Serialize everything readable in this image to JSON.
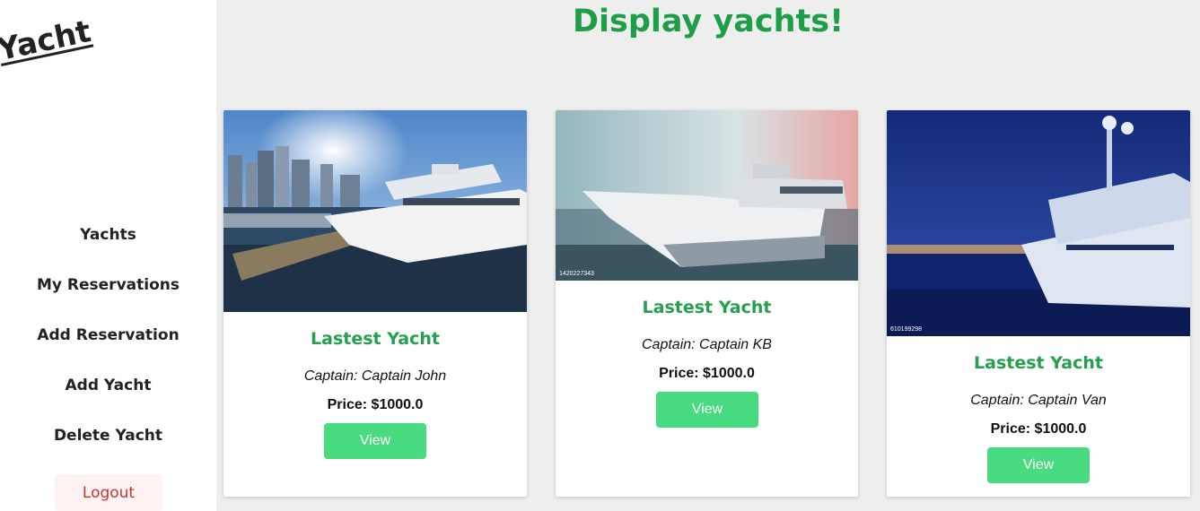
{
  "sidebar": {
    "logo": "Yacht",
    "items": [
      {
        "label": "Yachts"
      },
      {
        "label": "My Reservations"
      },
      {
        "label": "Add Reservation"
      },
      {
        "label": "Add Yacht"
      },
      {
        "label": "Delete Yacht"
      }
    ],
    "logout": "Logout"
  },
  "main": {
    "title": "Display yachts!",
    "cards": [
      {
        "title": "Lastest Yacht",
        "captain": "Captain: Captain John",
        "price": "Price: $1000.0",
        "button": "View",
        "image": "yacht-at-city-marina-photo"
      },
      {
        "title": "Lastest Yacht",
        "captain": "Captain: Captain KB",
        "price": "Price: $1000.0",
        "button": "View",
        "image": "superyacht-bow-photo",
        "image_caption": "1420227343"
      },
      {
        "title": "Lastest Yacht",
        "captain": "Captain: Captain Van",
        "price": "Price: $1000.0",
        "button": "View",
        "image": "yacht-at-night-photo",
        "image_caption": "610199298"
      }
    ]
  },
  "colors": {
    "title_green": "#1f9e48",
    "card_title_green": "#25a04f",
    "button_green": "#48db80",
    "logout_text": "#cc3333",
    "logout_bg": "#fff2f2",
    "page_bg": "#eeeeee"
  }
}
